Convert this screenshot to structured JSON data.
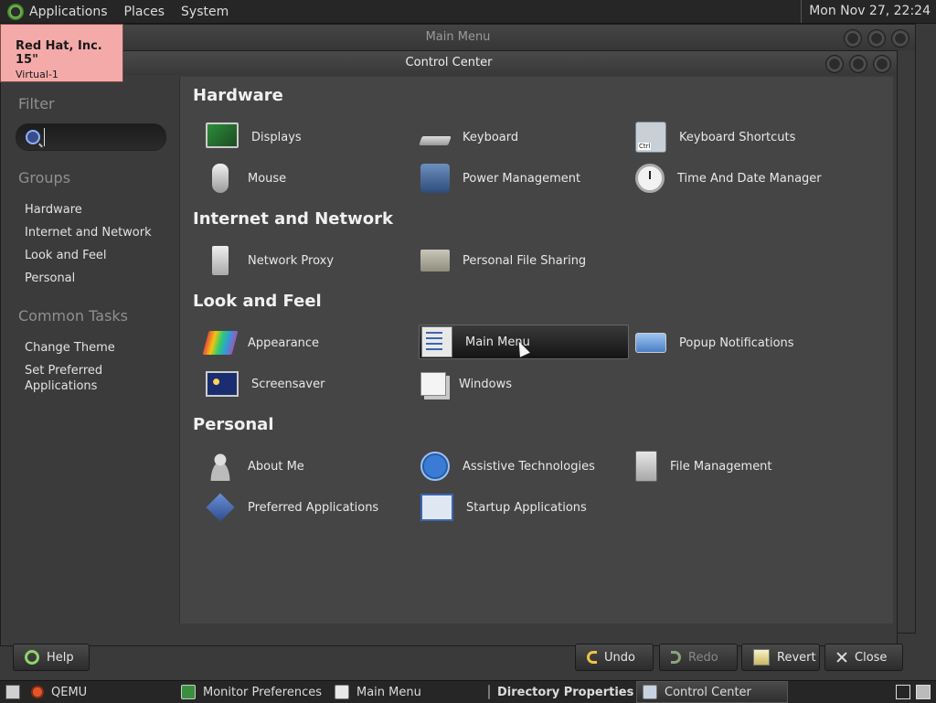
{
  "top_panel": {
    "menus": [
      "Applications",
      "Places",
      "System"
    ],
    "clock": "Mon Nov 27, 22:24"
  },
  "notification": {
    "title": "Red Hat, Inc. 15\"",
    "subtitle": "Virtual-1"
  },
  "bg_window": {
    "title": "Main Menu"
  },
  "control_center": {
    "title": "Control Center",
    "sidebar": {
      "filter_heading": "Filter",
      "filter_value": "",
      "groups_heading": "Groups",
      "groups": [
        "Hardware",
        "Internet and Network",
        "Look and Feel",
        "Personal"
      ],
      "tasks_heading": "Common Tasks",
      "tasks": [
        "Change Theme",
        "Set Preferred Applications"
      ]
    },
    "sections": [
      {
        "title": "Hardware",
        "items": [
          {
            "label": "Displays",
            "icon": "display-icon"
          },
          {
            "label": "Keyboard",
            "icon": "keyboard-icon"
          },
          {
            "label": "Keyboard Shortcuts",
            "icon": "keyboard-shortcuts-icon"
          },
          {
            "label": "Mouse",
            "icon": "mouse-icon"
          },
          {
            "label": "Power Management",
            "icon": "power-management-icon"
          },
          {
            "label": "Time And Date Manager",
            "icon": "clock-icon"
          }
        ]
      },
      {
        "title": "Internet and Network",
        "items": [
          {
            "label": "Network Proxy",
            "icon": "network-proxy-icon"
          },
          {
            "label": "Personal File Sharing",
            "icon": "folder-icon"
          }
        ]
      },
      {
        "title": "Look and Feel",
        "items": [
          {
            "label": "Appearance",
            "icon": "appearance-icon"
          },
          {
            "label": "Main Menu",
            "icon": "main-menu-icon"
          },
          {
            "label": "Popup Notifications",
            "icon": "popup-notifications-icon"
          },
          {
            "label": "Screensaver",
            "icon": "screensaver-icon"
          },
          {
            "label": "Windows",
            "icon": "windows-icon"
          }
        ]
      },
      {
        "title": "Personal",
        "items": [
          {
            "label": "About Me",
            "icon": "about-me-icon"
          },
          {
            "label": "Assistive Technologies",
            "icon": "assistive-icon"
          },
          {
            "label": "File Management",
            "icon": "file-management-icon"
          },
          {
            "label": "Preferred Applications",
            "icon": "preferred-applications-icon"
          },
          {
            "label": "Startup Applications",
            "icon": "startup-applications-icon"
          }
        ]
      }
    ],
    "buttons": {
      "help": "Help",
      "undo": "Undo",
      "redo": "Redo",
      "revert": "Revert",
      "close": "Close"
    }
  },
  "taskbar": {
    "items": [
      "QEMU",
      "Monitor Preferences",
      "Main Menu",
      "Directory Properties",
      "Control Center"
    ]
  },
  "colors": {
    "notification_bg": "#f5aaaa",
    "panel_bg": "#262626",
    "content_bg": "#454545"
  }
}
